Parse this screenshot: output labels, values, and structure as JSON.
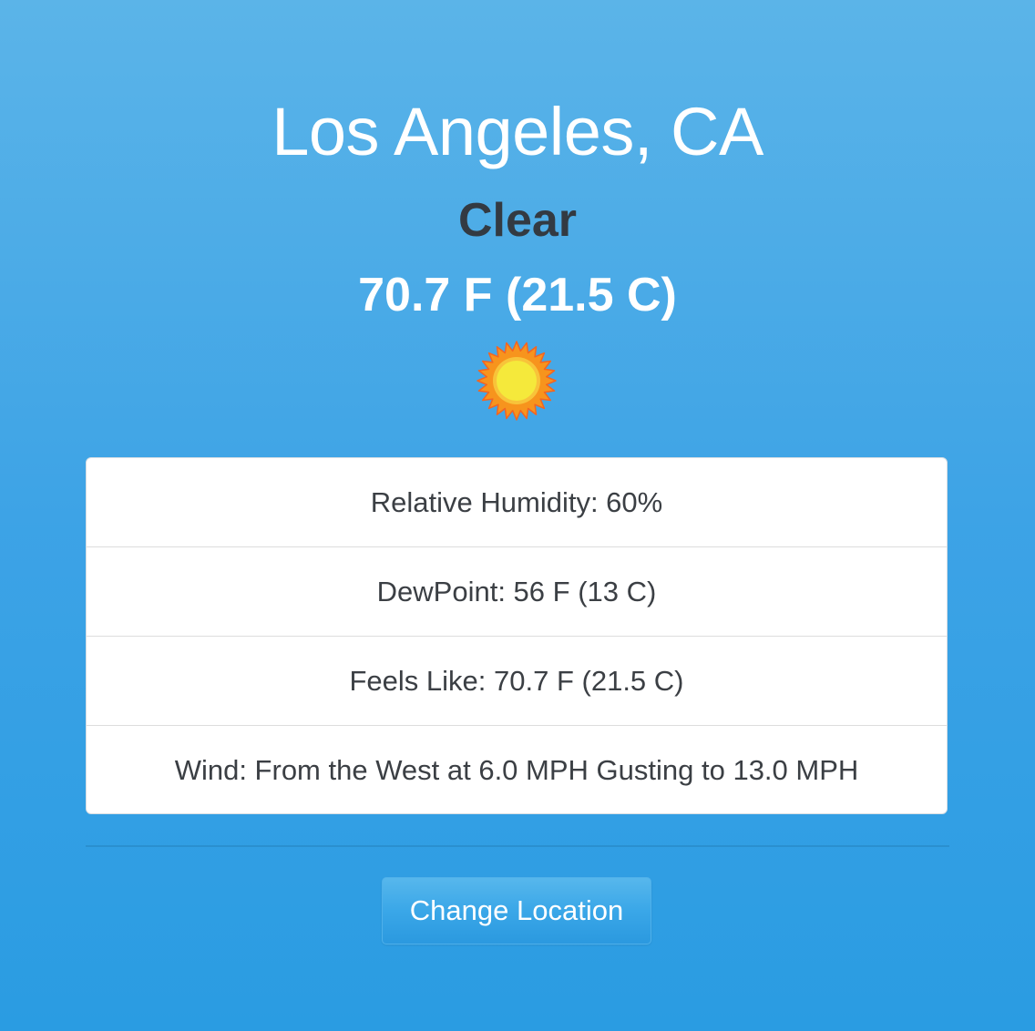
{
  "location": {
    "city": "Los Angeles, CA"
  },
  "current": {
    "condition": "Clear",
    "temperature": "70.7 F (21.5 C)",
    "icon": "sun-icon"
  },
  "details": [
    {
      "label": "Relative Humidity: 60%"
    },
    {
      "label": "DewPoint: 56 F (13 C)"
    },
    {
      "label": "Feels Like: 70.7 F (21.5 C)"
    },
    {
      "label": "Wind: From the West at 6.0 MPH Gusting to 13.0 MPH"
    }
  ],
  "actions": {
    "change_location_label": "Change Location"
  },
  "colors": {
    "background_top": "#5bb4e8",
    "background_bottom": "#2a9ce2",
    "condition_text": "#333a42",
    "sun_outer": "#f7941d",
    "sun_inner": "#f5e93b"
  }
}
